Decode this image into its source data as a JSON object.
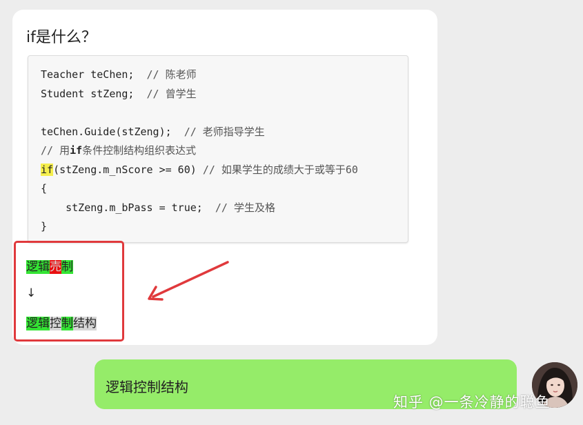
{
  "question": {
    "text": "if是什么？"
  },
  "code": {
    "line1": {
      "code": "Teacher teChen;  ",
      "comment": "// 陈老师"
    },
    "line2": {
      "code": "Student stZeng;  ",
      "comment": "// 曾学生"
    },
    "line4": {
      "code": "teChen.Guide(stZeng);  ",
      "comment": "// 老师指导学生"
    },
    "line5": {
      "prefix": "// 用",
      "keyword": "if",
      "suffix": "条件控制结构组织表达式"
    },
    "line6": {
      "keyword": "if",
      "rest": "(stZeng.m_nScore >= 60) ",
      "comment": "// 如果学生的成绩大于或等于60"
    },
    "line7": "{",
    "line8": {
      "code": "    stZeng.m_bPass = true;  ",
      "comment": "// 学生及格"
    },
    "line9": "}"
  },
  "annotation": {
    "line1": {
      "seg1": "逻辑",
      "seg2": "売",
      "seg3": "制"
    },
    "arrow": "↓",
    "line2": {
      "seg1": "逻辑",
      "seg2": "控",
      "seg3": "制",
      "seg4": "结构"
    }
  },
  "reply": {
    "text": "逻辑控制结构"
  },
  "watermark": {
    "text": "知乎 @一条冷静的聪鱼"
  },
  "colors": {
    "highlight_green": "#34e434",
    "highlight_red": "#e81010",
    "highlight_gray": "#d6d6d6",
    "reply_bubble": "#95ec69",
    "annotation_red": "#e0393c",
    "keyword_yellow": "#f5ee4d"
  }
}
